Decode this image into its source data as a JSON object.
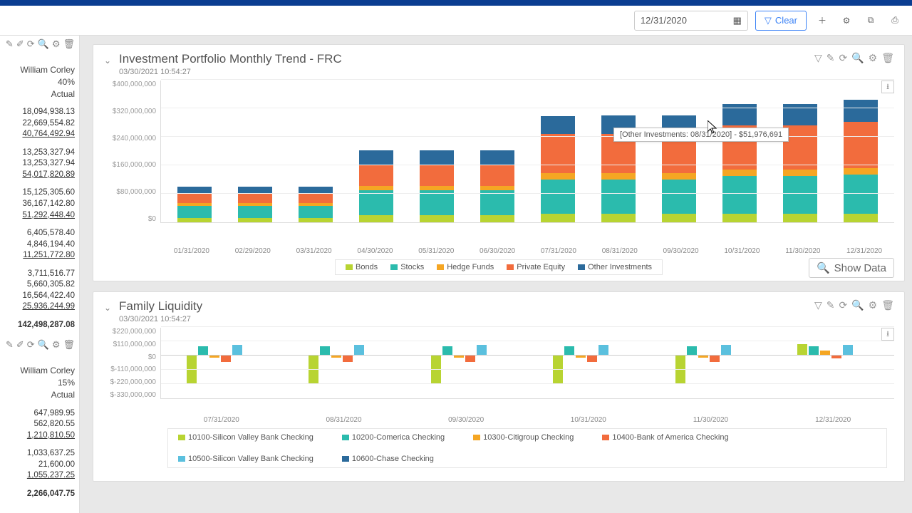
{
  "toolbar": {
    "date": "12/31/2020",
    "clear": "Clear"
  },
  "sidebar": {
    "panel1": {
      "name": "William Corley",
      "pct": "40%",
      "mode": "Actual",
      "rows": [
        [
          "18,094,938.13",
          "22,669,554.82",
          "40,764,492.94"
        ],
        [
          "13,253,327.94",
          "13,253,327.94",
          "54,017,820.89"
        ],
        [
          "15,125,305.60",
          "36,167,142.80",
          "51,292,448.40"
        ],
        [
          "6,405,578.40",
          "4,846,194.40",
          "11,251,772.80"
        ],
        [
          "3,711,516.77",
          "5,660,305.82",
          "16,564,422.40",
          "25,936,244.99"
        ],
        [
          "142,498,287.08"
        ]
      ]
    },
    "panel2": {
      "name": "William Corley",
      "pct": "15%",
      "mode": "Actual",
      "rows": [
        [
          "647,989.95",
          "562,820.55",
          "1,210,810.50"
        ],
        [
          "1,033,637.25",
          "21,600.00",
          "1,055,237.25"
        ],
        [
          "2,266,047.75"
        ]
      ]
    }
  },
  "cards": {
    "c1": {
      "title": "Investment Portfolio Monthly Trend - FRC",
      "sub": "03/30/2021 10:54:27"
    },
    "c2": {
      "title": "Family Liquidity",
      "sub": "03/30/2021 10:54:27"
    }
  },
  "chart_data": [
    {
      "type": "bar",
      "stacked": true,
      "title": "Investment Portfolio Monthly Trend - FRC",
      "ylabel": "",
      "ylim": [
        0,
        400000000
      ],
      "yticks": [
        "$400,000,000",
        "$320,000,000",
        "$240,000,000",
        "$160,000,000",
        "$80,000,000",
        "$0"
      ],
      "categories": [
        "01/31/2020",
        "02/29/2020",
        "03/31/2020",
        "04/30/2020",
        "05/31/2020",
        "06/30/2020",
        "07/31/2020",
        "08/31/2020",
        "09/30/2020",
        "10/31/2020",
        "11/30/2020",
        "12/31/2020"
      ],
      "series": [
        {
          "name": "Bonds",
          "color": "#b8d432",
          "values": [
            12000000,
            12000000,
            12000000,
            20000000,
            20000000,
            20000000,
            25000000,
            25000000,
            25000000,
            25000000,
            25000000,
            25000000
          ]
        },
        {
          "name": "Stocks",
          "color": "#2bbbad",
          "values": [
            35000000,
            35000000,
            35000000,
            70000000,
            70000000,
            70000000,
            95000000,
            95000000,
            95000000,
            105000000,
            105000000,
            110000000
          ]
        },
        {
          "name": "Hedge Funds",
          "color": "#f5a623",
          "values": [
            8000000,
            8000000,
            8000000,
            12000000,
            12000000,
            12000000,
            18000000,
            18000000,
            18000000,
            18000000,
            18000000,
            18000000
          ]
        },
        {
          "name": "Private Equity",
          "color": "#f26c3d",
          "values": [
            25000000,
            25000000,
            25000000,
            60000000,
            60000000,
            60000000,
            110000000,
            110000000,
            110000000,
            125000000,
            125000000,
            130000000
          ]
        },
        {
          "name": "Other Investments",
          "color": "#2b6a9b",
          "values": [
            20000000,
            20000000,
            20000000,
            40000000,
            40000000,
            40000000,
            50000000,
            51976691,
            51976691,
            60000000,
            60000000,
            62000000
          ]
        }
      ],
      "tooltip": "[Other Investments: 08/31/2020] - $51,976,691"
    },
    {
      "type": "bar",
      "grouped": true,
      "title": "Family Liquidity",
      "ylim": [
        -330000000,
        220000000
      ],
      "yticks": [
        "$220,000,000",
        "$110,000,000",
        "$0",
        "$-110,000,000",
        "$-220,000,000",
        "$-330,000,000"
      ],
      "categories": [
        "07/31/2020",
        "08/31/2020",
        "09/30/2020",
        "10/31/2020",
        "11/30/2020",
        "12/31/2020"
      ],
      "series": [
        {
          "name": "10100-Silicon Valley Bank Checking",
          "color": "#b8d432",
          "values": [
            -220000000,
            -220000000,
            -220000000,
            -220000000,
            -220000000,
            90000000
          ]
        },
        {
          "name": "10200-Comerica Checking",
          "color": "#2bbbad",
          "values": [
            70000000,
            70000000,
            70000000,
            70000000,
            70000000,
            70000000
          ]
        },
        {
          "name": "10300-Citigroup Checking",
          "color": "#f5a623",
          "values": [
            -15000000,
            -15000000,
            -15000000,
            -15000000,
            -15000000,
            40000000
          ]
        },
        {
          "name": "10400-Bank of America Checking",
          "color": "#f26c3d",
          "values": [
            -50000000,
            -50000000,
            -50000000,
            -50000000,
            -50000000,
            -20000000
          ]
        },
        {
          "name": "10500-Silicon Valley Bank Checking",
          "color": "#5bc0de",
          "values": [
            80000000,
            80000000,
            80000000,
            80000000,
            80000000,
            80000000
          ]
        },
        {
          "name": "10600-Chase Checking",
          "color": "#2b6a9b",
          "values": [
            0,
            0,
            0,
            0,
            0,
            0
          ]
        }
      ]
    }
  ],
  "show_data": "Show Data",
  "legend1": [
    "Bonds",
    "Stocks",
    "Hedge Funds",
    "Private Equity",
    "Other Investments"
  ],
  "legend2": [
    "10100-Silicon Valley Bank Checking",
    "10200-Comerica Checking",
    "10300-Citigroup Checking",
    "10400-Bank of America Checking",
    "10500-Silicon Valley Bank Checking",
    "10600-Chase Checking"
  ]
}
